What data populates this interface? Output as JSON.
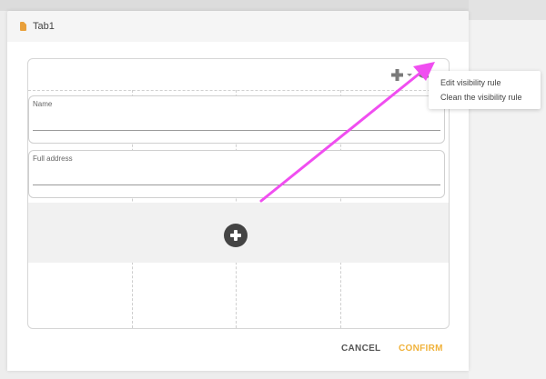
{
  "background": {
    "right_items": [
      "",
      "",
      ""
    ]
  },
  "modal": {
    "tab_title": "Tab1"
  },
  "toolbar": {
    "add_icon": "plus-icon",
    "visibility_icon": "eye-icon"
  },
  "fields": [
    {
      "label": "Name"
    },
    {
      "label": "Full address"
    }
  ],
  "dropdown": {
    "items": [
      "Edit visibility rule",
      "Clean the visibility rule"
    ]
  },
  "footer": {
    "cancel_label": "CANCEL",
    "confirm_label": "CONFIRM"
  },
  "colors": {
    "accent": "#f0b23b",
    "annotation_arrow": "#f04ef0",
    "tab_icon": "#e9a03b"
  }
}
